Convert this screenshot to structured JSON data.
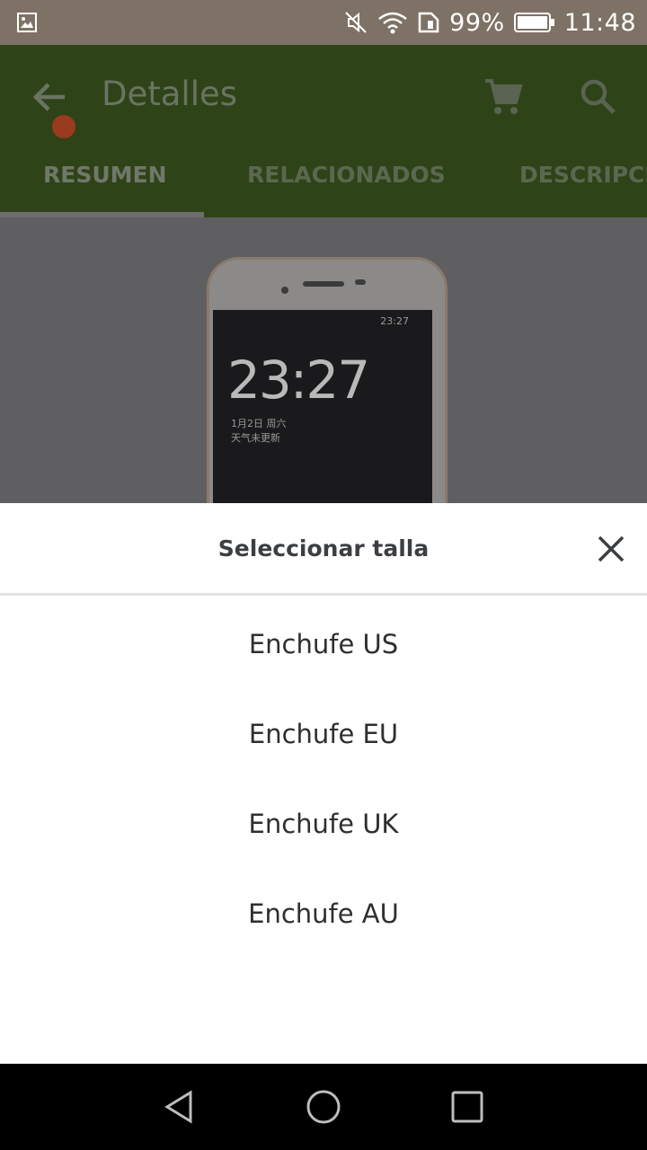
{
  "status_bar": {
    "battery": "99%",
    "time": "11:48",
    "icons": [
      "image-icon",
      "mute-icon",
      "wifi-icon",
      "sim-icon",
      "battery-icon"
    ]
  },
  "app_bar": {
    "title": "Detalles",
    "icons": [
      "back-arrow-icon",
      "cart-icon",
      "search-icon"
    ]
  },
  "tabs": [
    "RESUMEN",
    "RELACIONADOS",
    "DESCRIPCI"
  ],
  "product_image": {
    "screen_time_big": "23:27",
    "screen_time_small": "23:27",
    "screen_date": "1月2日 周六",
    "screen_weather": "天气未更新"
  },
  "sheet": {
    "title": "Seleccionar talla",
    "options": [
      "Enchufe US",
      "Enchufe EU",
      "Enchufe UK",
      "Enchufe AU"
    ]
  },
  "nav_bar": {
    "icons": [
      "back-triangle-icon",
      "home-circle-icon",
      "recents-square-icon"
    ]
  },
  "colors": {
    "app_bar_dimmed": "#2f4319",
    "status_bar": "#7e7266",
    "sheet_background": "#ffffff"
  }
}
